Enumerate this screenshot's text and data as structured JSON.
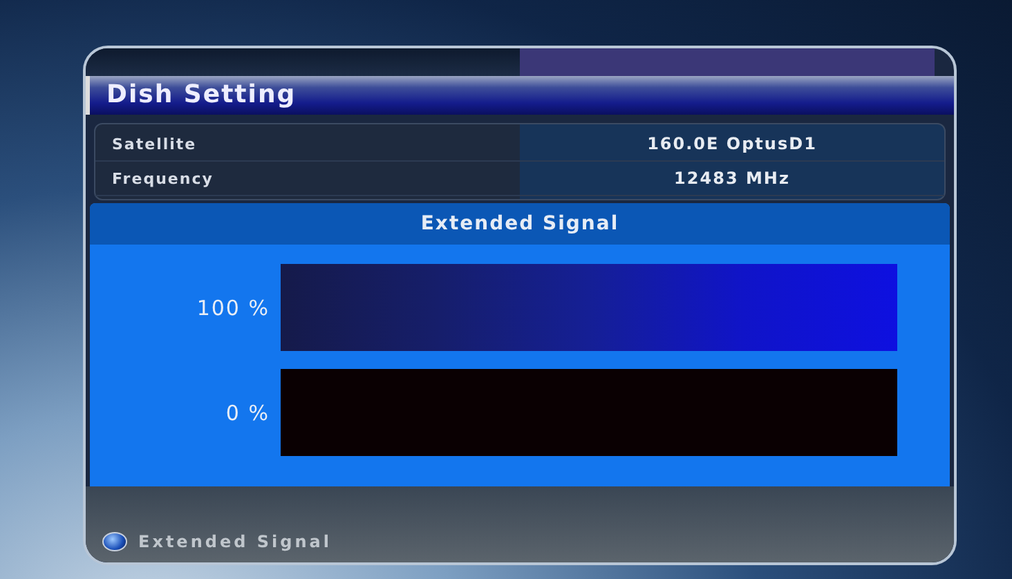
{
  "title": "Dish Setting",
  "info_rows": [
    {
      "label": "Satellite",
      "value": "160.0E OptusD1"
    },
    {
      "label": "Frequency",
      "value": "12483 MHz"
    }
  ],
  "popup": {
    "title": "Extended Signal",
    "meters": [
      {
        "reading": "100 %",
        "level": 1
      },
      {
        "reading": "0 %",
        "level": 0
      }
    ]
  },
  "footer": {
    "hint": "Extended Signal"
  }
}
